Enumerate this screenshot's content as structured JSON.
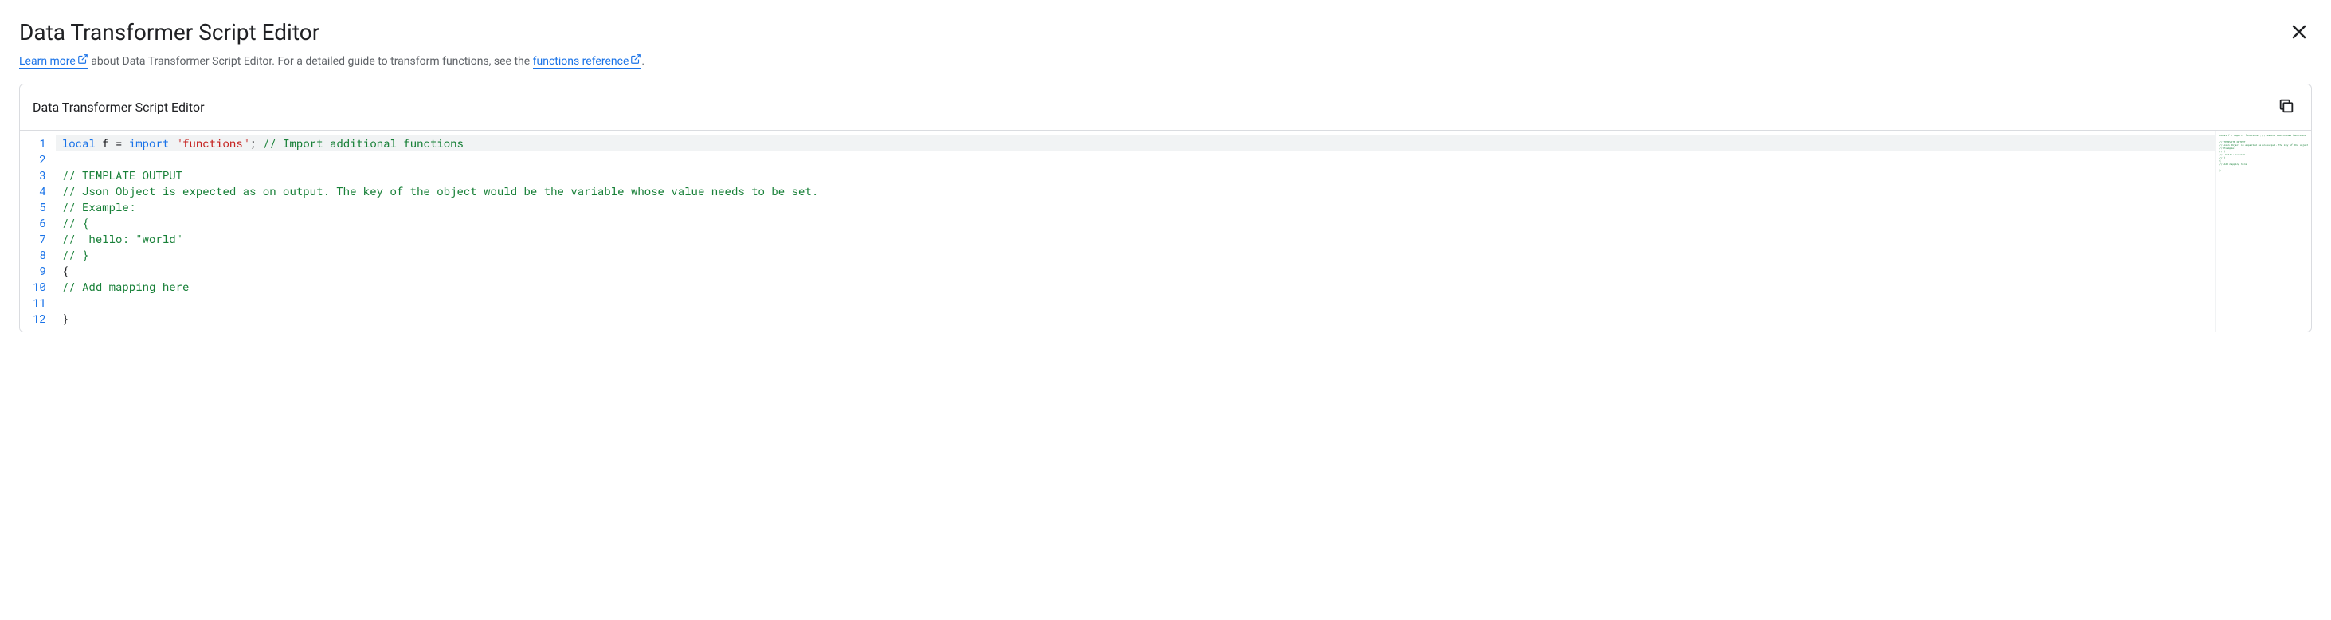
{
  "header": {
    "title": "Data Transformer Script Editor"
  },
  "subtitle": {
    "learn_more_label": "Learn more",
    "text_after_learn": " about Data Transformer Script Editor. For a detailed guide to transform functions, see the ",
    "functions_ref_label": "functions reference",
    "text_end": "."
  },
  "editor": {
    "title": "Data Transformer Script Editor",
    "lines": [
      {
        "num": 1,
        "highlighted": true,
        "tokens": [
          {
            "t": "keyword",
            "v": "local"
          },
          {
            "t": "plain",
            "v": " f = "
          },
          {
            "t": "keyword",
            "v": "import"
          },
          {
            "t": "plain",
            "v": " "
          },
          {
            "t": "string",
            "v": "\"functions\""
          },
          {
            "t": "punct",
            "v": ";"
          },
          {
            "t": "plain",
            "v": " "
          },
          {
            "t": "comment",
            "v": "// Import additional functions"
          }
        ]
      },
      {
        "num": 2,
        "tokens": []
      },
      {
        "num": 3,
        "tokens": [
          {
            "t": "comment",
            "v": "// TEMPLATE OUTPUT"
          }
        ]
      },
      {
        "num": 4,
        "tokens": [
          {
            "t": "comment",
            "v": "// Json Object is expected as on output. The key of the object would be the variable whose value needs to be set."
          }
        ]
      },
      {
        "num": 5,
        "tokens": [
          {
            "t": "comment",
            "v": "// Example:"
          }
        ]
      },
      {
        "num": 6,
        "tokens": [
          {
            "t": "comment",
            "v": "// {"
          }
        ]
      },
      {
        "num": 7,
        "tokens": [
          {
            "t": "comment",
            "v": "//  hello: \"world\""
          }
        ]
      },
      {
        "num": 8,
        "tokens": [
          {
            "t": "comment",
            "v": "// }"
          }
        ]
      },
      {
        "num": 9,
        "tokens": [
          {
            "t": "punct",
            "v": "{"
          }
        ]
      },
      {
        "num": 10,
        "tokens": [
          {
            "t": "comment",
            "v": "// Add mapping here"
          }
        ]
      },
      {
        "num": 11,
        "tokens": []
      },
      {
        "num": 12,
        "tokens": [
          {
            "t": "punct",
            "v": "}"
          }
        ]
      }
    ]
  }
}
